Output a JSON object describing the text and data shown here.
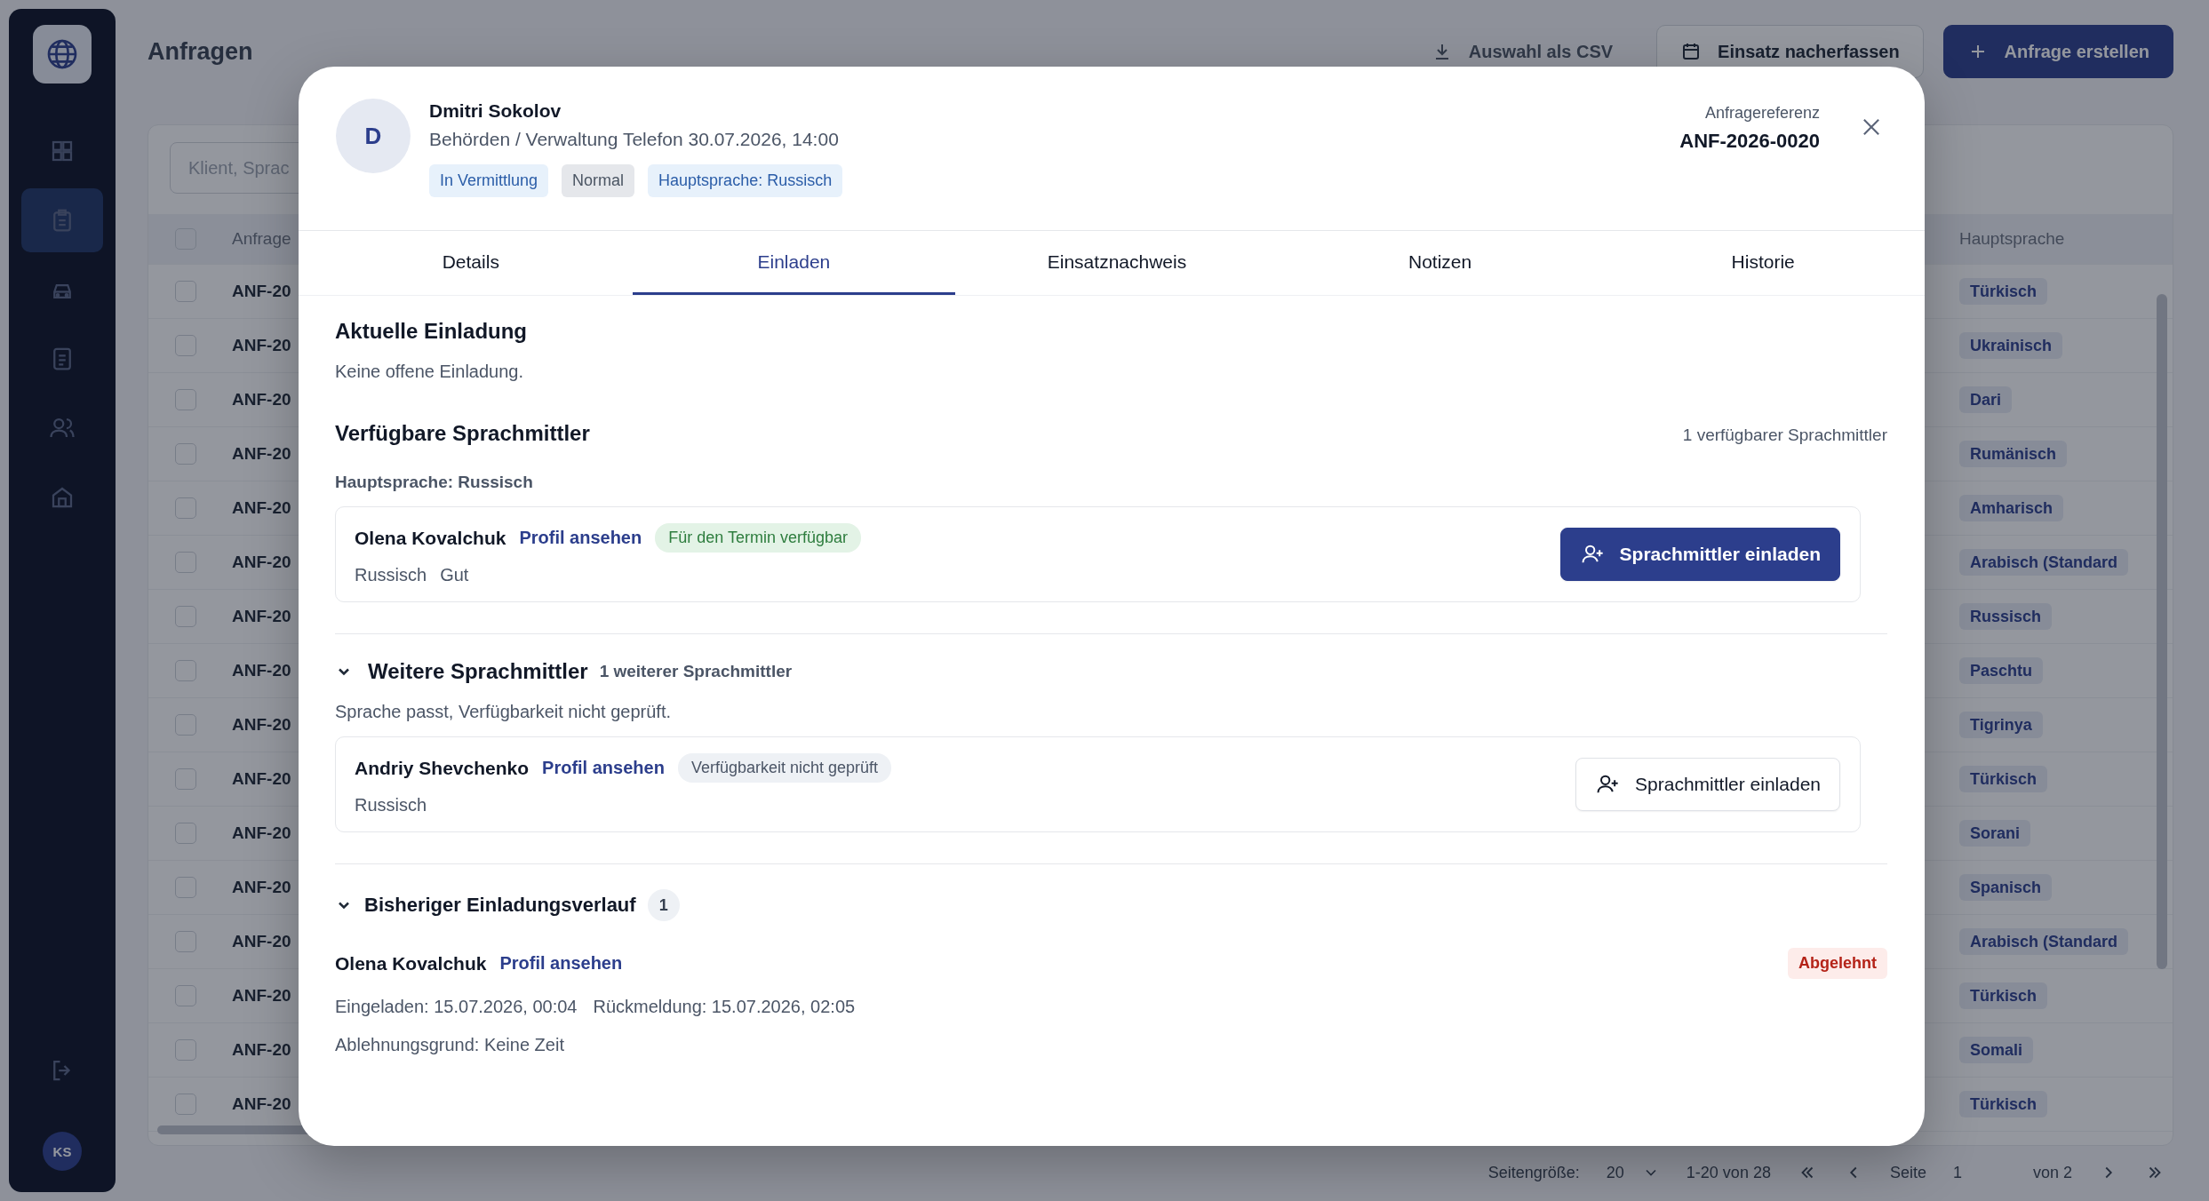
{
  "sidebar": {
    "items": [
      {
        "selected": false
      },
      {
        "selected": true
      },
      {
        "selected": false
      },
      {
        "selected": false
      },
      {
        "selected": false
      },
      {
        "selected": false
      }
    ],
    "user_initials": "KS"
  },
  "page_title": "Anfragen",
  "actions": [
    {
      "label": "Auswahl als CSV",
      "kind": "ghost"
    },
    {
      "label": "Einsatz nacherfassen",
      "kind": "secondary"
    },
    {
      "label": "Anfrage erstellen",
      "kind": "primary"
    }
  ],
  "search": {
    "placeholder": "Klient, Sprac"
  },
  "table": {
    "columns": [
      "Anfrage",
      "Hauptsprache"
    ],
    "all_checked": false,
    "rows": [
      {
        "checked": false,
        "id": "ANF-20",
        "language": "Türkisch"
      },
      {
        "checked": false,
        "id": "ANF-20",
        "language": "Ukrainisch"
      },
      {
        "checked": false,
        "id": "ANF-20",
        "language": "Dari"
      },
      {
        "checked": false,
        "id": "ANF-20",
        "language": "Rumänisch"
      },
      {
        "checked": false,
        "id": "ANF-20",
        "language": "Amharisch"
      },
      {
        "checked": false,
        "id": "ANF-20",
        "language": "Arabisch (Standard"
      },
      {
        "checked": false,
        "id": "ANF-20",
        "language": "Russisch"
      },
      {
        "checked": false,
        "id": "ANF-20",
        "language": "Paschtu"
      },
      {
        "checked": false,
        "id": "ANF-20",
        "language": "Tigrinya"
      },
      {
        "checked": false,
        "id": "ANF-20",
        "language": "Türkisch"
      },
      {
        "checked": false,
        "id": "ANF-20",
        "language": "Sorani"
      },
      {
        "checked": false,
        "id": "ANF-20",
        "language": "Spanisch"
      },
      {
        "checked": false,
        "id": "ANF-20",
        "language": "Arabisch (Standard"
      },
      {
        "checked": false,
        "id": "ANF-20",
        "language": "Türkisch"
      },
      {
        "checked": false,
        "id": "ANF-20",
        "language": "Somali"
      },
      {
        "checked": false,
        "id": "ANF-20",
        "language": "Türkisch"
      }
    ]
  },
  "pagination": {
    "page_size_label": "Seitengröße:",
    "page_size": "20",
    "range": "1-20 von 28",
    "page_label": "Seite",
    "page": "1",
    "page_total": "von 2"
  },
  "dialog": {
    "avatar": "D",
    "client": "Dmitri Sokolov",
    "subtitle": "Behörden / Verwaltung Telefon 30.07.2026, 14:00",
    "chips": [
      {
        "label": "In Vermittlung",
        "kind": "info"
      },
      {
        "label": "Normal",
        "kind": "neutral"
      },
      {
        "label": "Hauptsprache: Russisch",
        "kind": "info"
      }
    ],
    "reference_label": "Anfragereferenz",
    "reference": "ANF-2026-0020",
    "tabs": [
      {
        "label": "Details",
        "selected": false
      },
      {
        "label": "Einladen",
        "selected": true
      },
      {
        "label": "Einsatznachweis",
        "selected": false
      },
      {
        "label": "Notizen",
        "selected": false
      },
      {
        "label": "Historie",
        "selected": false
      }
    ],
    "current": {
      "title": "Aktuelle Einladung",
      "text": "Keine offene Einladung."
    },
    "available": {
      "title": "Verfügbare Sprachmittler",
      "count": "1 verfügbarer Sprachmittler",
      "language_label": "Hauptsprache: Russisch",
      "interpreters": [
        {
          "name": "Olena Kovalchuk",
          "profile_link": "Profil ansehen",
          "availability": {
            "label": "Für den Termin verfügbar",
            "kind": "available"
          },
          "languages": [
            "Russisch",
            "Gut"
          ],
          "button": {
            "label": "Sprachmittler einladen",
            "primary": true
          }
        }
      ]
    },
    "further": {
      "title": "Weitere Sprachmittler",
      "count": "1 weiterer Sprachmittler",
      "expanded": true,
      "description": "Sprache passt, Verfügbarkeit nicht geprüft.",
      "interpreters": [
        {
          "name": "Andriy Shevchenko",
          "profile_link": "Profil ansehen",
          "availability": {
            "label": "Verfügbarkeit nicht geprüft",
            "kind": "unchecked"
          },
          "languages": [
            "Russisch"
          ],
          "button": {
            "label": "Sprachmittler einladen",
            "primary": false
          }
        }
      ]
    },
    "history": {
      "title": "Bisheriger Einladungsverlauf",
      "count": "1",
      "expanded": true,
      "entries": [
        {
          "name": "Olena Kovalchuk",
          "profile_link": "Profil ansehen",
          "status": "Abgelehnt",
          "invited": "Eingeladen: 15.07.2026, 00:04",
          "response": "Rückmeldung: 15.07.2026, 02:05",
          "reason": "Ablehnungsgrund: Keine Zeit"
        }
      ]
    }
  }
}
